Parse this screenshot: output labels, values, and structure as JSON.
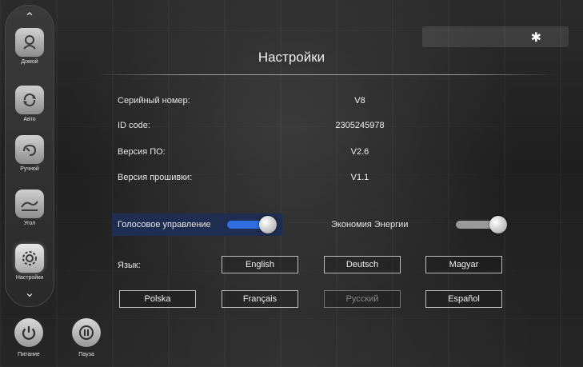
{
  "colors": {
    "accent": "#2f6de0",
    "highlight_bg": "#1f2d52"
  },
  "sidebar": {
    "items": [
      {
        "label": "Домой",
        "icon": "home-massage-icon",
        "active": false
      },
      {
        "label": "Авто",
        "icon": "auto-cycle-icon",
        "active": false
      },
      {
        "label": "Ручной",
        "icon": "manual-hand-icon",
        "active": false
      },
      {
        "label": "Угол",
        "icon": "angle-recline-icon",
        "active": false
      },
      {
        "label": "Настройки",
        "icon": "settings-gear-icon",
        "active": true
      }
    ]
  },
  "bottom": {
    "power_label": "Питание",
    "pause_label": "Пауза"
  },
  "status": {
    "bluetooth_icon": "bluetooth-icon"
  },
  "header": {
    "title": "Настройки"
  },
  "info": {
    "serial_label": "Серийный номер:",
    "serial_value": "V8",
    "id_label": "ID code:",
    "id_value": "2305245978",
    "software_label": "Версия ПО:",
    "software_value": "V2.6",
    "firmware_label": "Версия прошивки:",
    "firmware_value": "V1.1"
  },
  "toggles": {
    "voice_label": "Голосовое управление",
    "voice_on": true,
    "energy_label": "Экономия Энергии",
    "energy_on": false
  },
  "language": {
    "label": "Язык:",
    "options": [
      "English",
      "Deutsch",
      "Magyar",
      "Polska",
      "Français",
      "Русский",
      "Español"
    ],
    "selected": "Русский"
  }
}
